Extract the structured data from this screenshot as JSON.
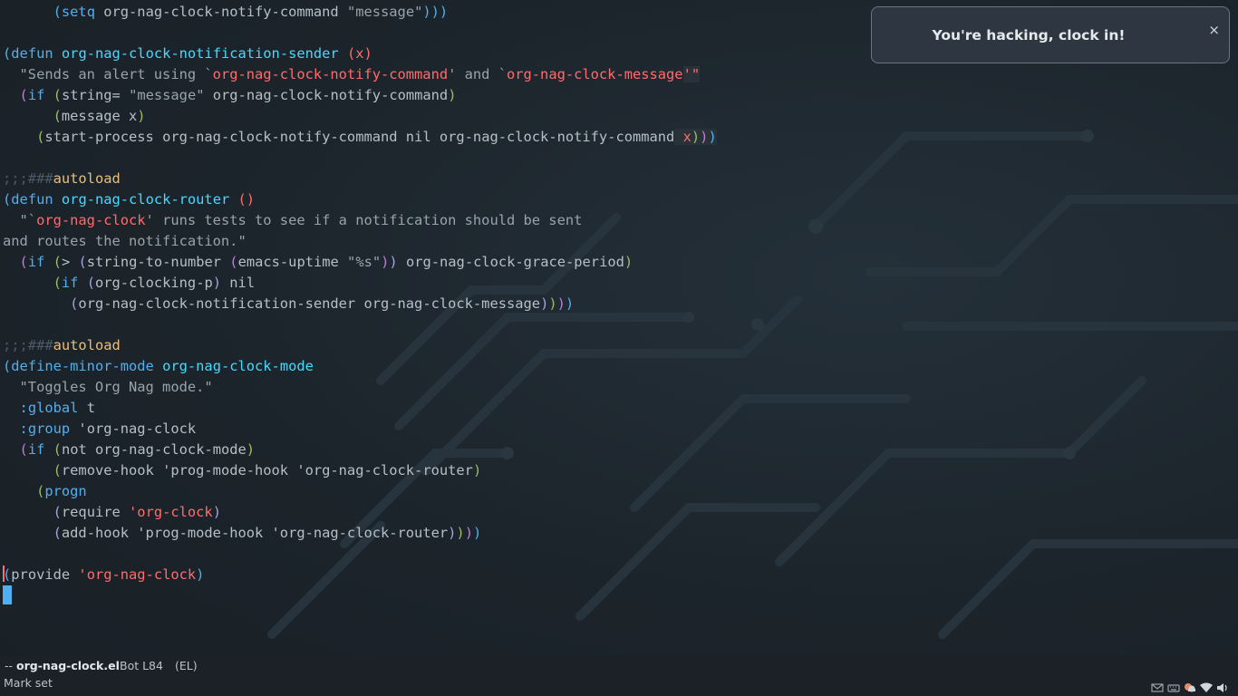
{
  "editor": {
    "lines": [
      [
        {
          "c": "",
          "t": "      "
        },
        {
          "c": "p1",
          "t": "("
        },
        {
          "c": "kw",
          "t": "setq"
        },
        {
          "c": "",
          "t": " org-nag-clock-notify-command "
        },
        {
          "c": "str",
          "t": "\"message\""
        },
        {
          "c": "p1",
          "t": ")))"
        }
      ],
      [],
      [
        {
          "c": "p1",
          "t": "("
        },
        {
          "c": "kw",
          "t": "defun"
        },
        {
          "c": "",
          "t": " "
        },
        {
          "c": "fn",
          "t": "org-nag-clock-notification-sender"
        },
        {
          "c": "",
          "t": " "
        },
        {
          "c": "sym",
          "t": "(x)"
        }
      ],
      [
        {
          "c": "str",
          "t": "  \"Sends an alert using `"
        },
        {
          "c": "sym",
          "t": "org-nag-clock-notify-command"
        },
        {
          "c": "str",
          "t": "' and `"
        },
        {
          "c": "sym",
          "t": "org-nag-clock-message"
        },
        {
          "c": "sym hl",
          "t": "'\""
        }
      ],
      [
        {
          "c": "",
          "t": "  "
        },
        {
          "c": "p2",
          "t": "("
        },
        {
          "c": "kw",
          "t": "if"
        },
        {
          "c": "",
          "t": " "
        },
        {
          "c": "p3",
          "t": "("
        },
        {
          "c": "",
          "t": "string= "
        },
        {
          "c": "str",
          "t": "\"message\""
        },
        {
          "c": "",
          "t": " org-nag-clock-notify-command"
        },
        {
          "c": "p3",
          "t": ")"
        }
      ],
      [
        {
          "c": "",
          "t": "      "
        },
        {
          "c": "p3",
          "t": "("
        },
        {
          "c": "",
          "t": "message x"
        },
        {
          "c": "p3",
          "t": ")"
        }
      ],
      [
        {
          "c": "",
          "t": "    "
        },
        {
          "c": "p3",
          "t": "("
        },
        {
          "c": "",
          "t": "start-process org-nag-clock-notify-command nil org-nag-clock-notify-command"
        },
        {
          "c": "hl",
          "t": " "
        },
        {
          "c": "sym hl",
          "t": "x"
        },
        {
          "c": "p3 hl",
          "t": ")"
        },
        {
          "c": "p2 hl",
          "t": ")"
        },
        {
          "c": "p1 hl",
          "t": ")"
        }
      ],
      [],
      [
        {
          "c": "cm",
          "t": ";;;###"
        },
        {
          "c": "ac",
          "t": "autoload"
        }
      ],
      [
        {
          "c": "p1",
          "t": "("
        },
        {
          "c": "kw",
          "t": "defun"
        },
        {
          "c": "",
          "t": " "
        },
        {
          "c": "fn",
          "t": "org-nag-clock-router"
        },
        {
          "c": "",
          "t": " "
        },
        {
          "c": "sym",
          "t": "()"
        }
      ],
      [
        {
          "c": "str",
          "t": "  \"`"
        },
        {
          "c": "sym",
          "t": "org-nag-clock"
        },
        {
          "c": "str",
          "t": "' runs tests to see if a notification should be sent"
        }
      ],
      [
        {
          "c": "str",
          "t": "and routes the notification.\""
        }
      ],
      [
        {
          "c": "",
          "t": "  "
        },
        {
          "c": "p2",
          "t": "("
        },
        {
          "c": "kw",
          "t": "if"
        },
        {
          "c": "",
          "t": " "
        },
        {
          "c": "p3",
          "t": "("
        },
        {
          "c": "",
          "t": "> "
        },
        {
          "c": "p4",
          "t": "("
        },
        {
          "c": "",
          "t": "string-to-number "
        },
        {
          "c": "p2",
          "t": "("
        },
        {
          "c": "",
          "t": "emacs-uptime "
        },
        {
          "c": "str",
          "t": "\"%s\""
        },
        {
          "c": "p2",
          "t": ")"
        },
        {
          "c": "p4",
          "t": ")"
        },
        {
          "c": "",
          "t": " org-nag-clock-grace-period"
        },
        {
          "c": "p3",
          "t": ")"
        }
      ],
      [
        {
          "c": "",
          "t": "      "
        },
        {
          "c": "p3",
          "t": "("
        },
        {
          "c": "kw",
          "t": "if"
        },
        {
          "c": "",
          "t": " "
        },
        {
          "c": "p4",
          "t": "("
        },
        {
          "c": "",
          "t": "org-clocking-p"
        },
        {
          "c": "p4",
          "t": ")"
        },
        {
          "c": "",
          "t": " nil"
        }
      ],
      [
        {
          "c": "",
          "t": "        "
        },
        {
          "c": "p4",
          "t": "("
        },
        {
          "c": "",
          "t": "org-nag-clock-notification-sender org-nag-clock-message"
        },
        {
          "c": "p4",
          "t": ")"
        },
        {
          "c": "p3",
          "t": ")"
        },
        {
          "c": "p2",
          "t": ")"
        },
        {
          "c": "p1",
          "t": ")"
        }
      ],
      [],
      [
        {
          "c": "cm",
          "t": ";;;###"
        },
        {
          "c": "ac",
          "t": "autoload"
        }
      ],
      [
        {
          "c": "p1",
          "t": "("
        },
        {
          "c": "kw",
          "t": "define-minor-mode"
        },
        {
          "c": "",
          "t": " "
        },
        {
          "c": "fn",
          "t": "org-nag-clock-mode"
        }
      ],
      [
        {
          "c": "str",
          "t": "  \"Toggles Org Nag mode.\""
        }
      ],
      [
        {
          "c": "",
          "t": "  "
        },
        {
          "c": "kw",
          "t": ":global"
        },
        {
          "c": "",
          "t": " t"
        }
      ],
      [
        {
          "c": "",
          "t": "  "
        },
        {
          "c": "kw",
          "t": ":group"
        },
        {
          "c": "",
          "t": " 'org-nag-clock"
        }
      ],
      [
        {
          "c": "",
          "t": "  "
        },
        {
          "c": "p2",
          "t": "("
        },
        {
          "c": "kw",
          "t": "if"
        },
        {
          "c": "",
          "t": " "
        },
        {
          "c": "p3",
          "t": "("
        },
        {
          "c": "",
          "t": "not org-nag-clock-mode"
        },
        {
          "c": "p3",
          "t": ")"
        }
      ],
      [
        {
          "c": "",
          "t": "      "
        },
        {
          "c": "p3",
          "t": "("
        },
        {
          "c": "",
          "t": "remove-hook 'prog-mode-hook 'org-nag-clock-router"
        },
        {
          "c": "p3",
          "t": ")"
        }
      ],
      [
        {
          "c": "",
          "t": "    "
        },
        {
          "c": "p3",
          "t": "("
        },
        {
          "c": "kw",
          "t": "progn"
        }
      ],
      [
        {
          "c": "",
          "t": "      "
        },
        {
          "c": "p4",
          "t": "("
        },
        {
          "c": "",
          "t": "require "
        },
        {
          "c": "sym",
          "t": "'org-clock"
        },
        {
          "c": "p4",
          "t": ")"
        }
      ],
      [
        {
          "c": "",
          "t": "      "
        },
        {
          "c": "p4",
          "t": "("
        },
        {
          "c": "",
          "t": "add-hook 'prog-mode-hook 'org-nag-clock-router"
        },
        {
          "c": "p4",
          "t": ")"
        },
        {
          "c": "p3",
          "t": ")"
        },
        {
          "c": "p2",
          "t": ")"
        },
        {
          "c": "p1",
          "t": ")"
        }
      ],
      [],
      [
        {
          "c": "mark",
          "t": ""
        },
        {
          "c": "p1",
          "t": "("
        },
        {
          "c": "",
          "t": "provide "
        },
        {
          "c": "sym",
          "t": "'org-nag-clock"
        },
        {
          "c": "p1",
          "t": ")"
        }
      ]
    ]
  },
  "modeline": {
    "prefix": "--",
    "buffer_name": "org-nag-clock.el",
    "position": "Bot L84",
    "mode": "(EL)"
  },
  "minibuffer": {
    "message": "Mark set"
  },
  "notification": {
    "text": "You're hacking, clock in!",
    "close_icon": "×"
  },
  "tray": {
    "icons": [
      "mail-icon",
      "keyboard-icon",
      "weather-icon",
      "wifi-icon",
      "volume-icon"
    ]
  },
  "colors": {
    "background": "#1d252c",
    "keyword": "#51afef",
    "function": "#46d9ff",
    "symbol": "#ff6c6b",
    "string": "#98a3ab",
    "comment": "#4b5a66",
    "autoload": "#ecbe7b",
    "cursor": "#51afef"
  }
}
